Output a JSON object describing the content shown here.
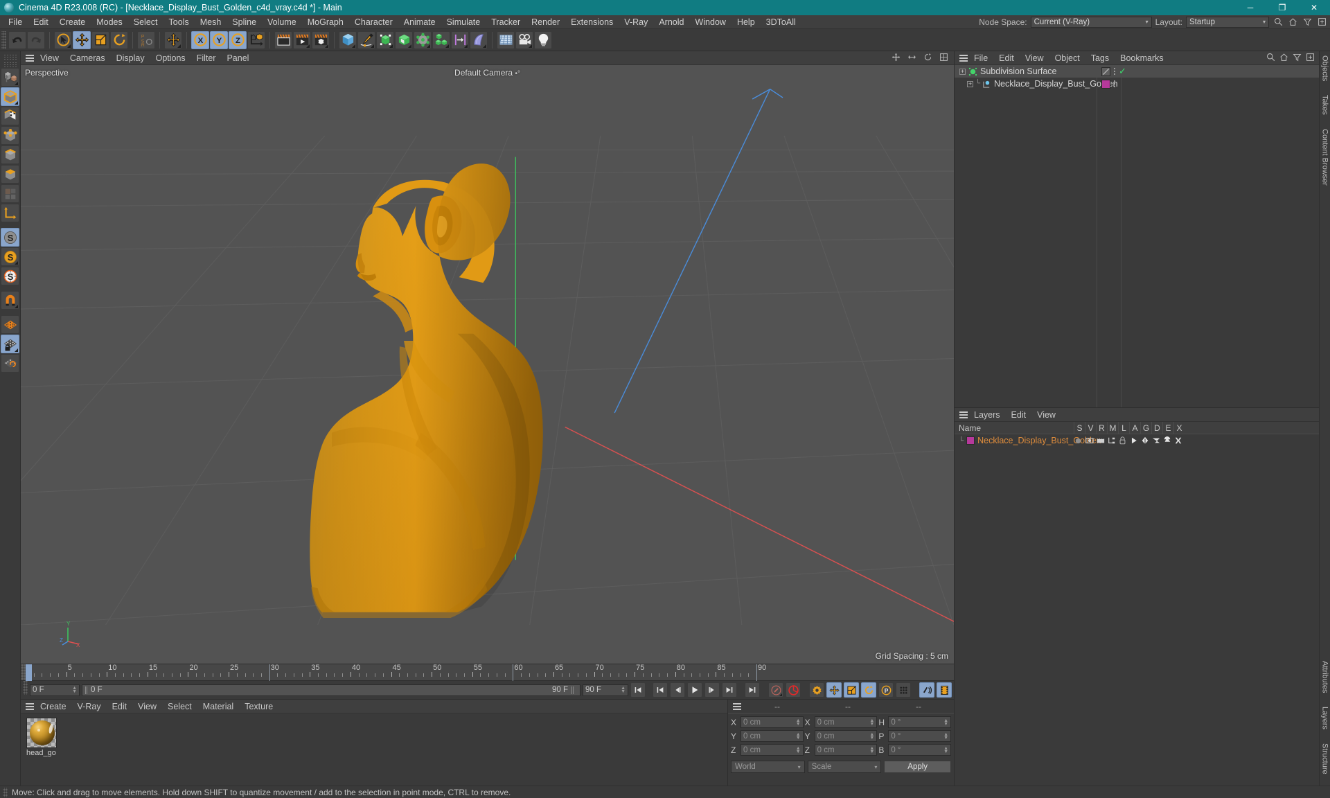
{
  "window": {
    "title": "Cinema 4D R23.008 (RC) - [Necklace_Display_Bust_Golden_c4d_vray.c4d *] - Main",
    "minimize": "─",
    "maximize": "❐",
    "close": "✕"
  },
  "menubar": {
    "items": [
      "File",
      "Edit",
      "Create",
      "Modes",
      "Select",
      "Tools",
      "Mesh",
      "Spline",
      "Volume",
      "MoGraph",
      "Character",
      "Animate",
      "Simulate",
      "Tracker",
      "Render",
      "Extensions",
      "V-Ray",
      "Arnold",
      "Window",
      "Help",
      "3DToAll"
    ],
    "node_space_label": "Node Space:",
    "node_space_value": "Current (V-Ray)",
    "layout_label": "Layout:",
    "layout_value": "Startup"
  },
  "toolbar": {
    "groups": [
      {
        "name": "history",
        "buttons": [
          {
            "icon": "undo-icon",
            "label": "Undo",
            "active": false
          },
          {
            "icon": "redo-icon",
            "label": "Redo",
            "active": false
          }
        ]
      },
      {
        "name": "tools",
        "buttons": [
          {
            "icon": "select-cursor-icon",
            "label": "Live Selection",
            "active": false
          },
          {
            "icon": "move-tool-icon",
            "label": "Move",
            "active": true
          },
          {
            "icon": "scale-tool-icon",
            "label": "Scale",
            "active": false
          },
          {
            "icon": "rotate-tool-icon",
            "label": "Rotate",
            "active": false
          }
        ]
      },
      {
        "name": "psr",
        "buttons": [
          {
            "icon": "psr-icon",
            "label": "PSR",
            "active": false
          }
        ]
      },
      {
        "name": "move-dup",
        "buttons": [
          {
            "icon": "move-tool-icon",
            "label": "Move",
            "active": false
          }
        ]
      },
      {
        "name": "axis-locks",
        "buttons": [
          {
            "icon": "axis-x-icon",
            "label": "X Axis",
            "active": true
          },
          {
            "icon": "axis-y-icon",
            "label": "Y Axis",
            "active": true
          },
          {
            "icon": "axis-z-icon",
            "label": "Z Axis",
            "active": true
          },
          {
            "icon": "world-object-axis-icon",
            "label": "World/Object",
            "active": false
          }
        ]
      },
      {
        "name": "render",
        "buttons": [
          {
            "icon": "render-view-icon",
            "label": "Render View",
            "active": false
          },
          {
            "icon": "render-to-picture-icon",
            "label": "Render to Picture Viewer",
            "active": false
          },
          {
            "icon": "render-settings-icon",
            "label": "Render Settings",
            "active": false
          }
        ]
      },
      {
        "name": "objects",
        "buttons": [
          {
            "icon": "cube-primitive-icon",
            "label": "Add Cube Object",
            "active": false
          },
          {
            "icon": "pen-spline-icon",
            "label": "Add Spline",
            "active": false
          },
          {
            "icon": "generator-icon",
            "label": "Add Generator",
            "active": false
          },
          {
            "icon": "deformer-icon",
            "label": "Add Deformer",
            "active": false
          },
          {
            "icon": "scene-nodes-icon",
            "label": "Add Scene Object",
            "active": false
          },
          {
            "icon": "mograph-icon",
            "label": "MoGraph",
            "active": false
          },
          {
            "icon": "snap-icon",
            "label": "Add Field",
            "active": false
          },
          {
            "icon": "cloth-icon",
            "label": "Add Simulation",
            "active": false
          }
        ]
      },
      {
        "name": "scene",
        "buttons": [
          {
            "icon": "environment-icon",
            "label": "Add Environment",
            "active": false
          },
          {
            "icon": "camera-icon",
            "label": "Add Camera",
            "active": false
          },
          {
            "icon": "light-icon",
            "label": "Add Light",
            "active": false
          }
        ]
      }
    ]
  },
  "lefttools": {
    "buttons": [
      {
        "icon": "make-editable-icon",
        "label": "Make Editable",
        "active": false
      },
      {
        "icon": "model-mode-icon",
        "label": "Model Mode",
        "active": true
      },
      {
        "icon": "texture-mode-icon",
        "label": "Texture Mode",
        "active": false
      },
      {
        "icon": "point-mode-icon",
        "label": "Points",
        "active": false
      },
      {
        "icon": "edge-mode-icon",
        "label": "Edges",
        "active": false
      },
      {
        "icon": "polygon-mode-icon",
        "label": "Polygons",
        "active": false
      },
      {
        "icon": "uv-mode-icon",
        "label": "UV Mesh",
        "active": false
      },
      {
        "icon": "axis-mode-icon",
        "label": "Enable Axis",
        "active": false
      },
      {
        "icon": "snap-s-gray-icon",
        "label": "Enable Snap",
        "active": true
      },
      {
        "icon": "snap-s-orange-icon",
        "label": "Snapping Settings",
        "active": false
      },
      {
        "icon": "snap-s-white-icon",
        "label": "Quantize",
        "active": false
      },
      {
        "icon": "magnet-icon",
        "label": "Magnet",
        "active": false
      },
      {
        "icon": "workplane-icon",
        "label": "Workplane",
        "active": false
      },
      {
        "icon": "workplane-lock-icon",
        "label": "Lock Workplane",
        "active": true
      },
      {
        "icon": "workplane-mode-icon",
        "label": "Planar Workplane",
        "active": false
      }
    ]
  },
  "viewport": {
    "menu": [
      "View",
      "Cameras",
      "Display",
      "Options",
      "Filter",
      "Panel"
    ],
    "projection_label": "Perspective",
    "camera_label": "Default Camera",
    "grid_spacing": "Grid Spacing : 5 cm",
    "axis_labels": {
      "x": "X",
      "y": "Y",
      "z": "Z"
    },
    "model_color": "#e8a117",
    "background_color": "#535353"
  },
  "timeline": {
    "ticks": [
      0,
      5,
      10,
      15,
      20,
      25,
      30,
      35,
      40,
      45,
      50,
      55,
      60,
      65,
      70,
      75,
      80,
      85,
      90
    ],
    "start_frame": "0 F",
    "current_frame": "0 F",
    "preview_min": "0 F",
    "end_frame": "90 F",
    "preview_max": "90 F",
    "range_end": "90 F",
    "transport": [
      {
        "icon": "go-to-start-icon",
        "label": "Go to Start"
      },
      {
        "icon": "previous-key-icon",
        "label": "Go to Previous Key"
      },
      {
        "icon": "step-back-icon",
        "label": "Go to Previous Frame"
      },
      {
        "icon": "play-icon",
        "label": "Play Forwards"
      },
      {
        "icon": "step-forward-icon",
        "label": "Go to Next Frame"
      },
      {
        "icon": "next-key-icon",
        "label": "Go to Next Key"
      },
      {
        "icon": "go-to-end-icon",
        "label": "Go to End"
      }
    ],
    "record_tools": [
      {
        "icon": "autokey-icon",
        "label": "Autokeying",
        "active": false
      },
      {
        "icon": "record-icon",
        "label": "Record Active Objects",
        "active": false
      },
      {
        "icon": "keyframe-selection-icon",
        "label": "Keyframe Selection",
        "active": false
      },
      {
        "icon": "position-key-icon",
        "label": "Position",
        "active": true
      },
      {
        "icon": "scale-key-icon",
        "label": "Scale",
        "active": true
      },
      {
        "icon": "rotation-key-icon",
        "label": "Rotation",
        "active": true
      },
      {
        "icon": "param-key-icon",
        "label": "Parameter",
        "active": true
      },
      {
        "icon": "pla-key-icon",
        "label": "Point Level Animation",
        "active": false
      },
      {
        "icon": "sound-icon",
        "label": "Sound",
        "active": true
      },
      {
        "icon": "timeline-icon",
        "label": "Timeline",
        "active": true
      }
    ]
  },
  "material_manager": {
    "menu": [
      "Create",
      "V-Ray",
      "Edit",
      "View",
      "Select",
      "Material",
      "Texture"
    ],
    "materials": [
      {
        "name": "head_go",
        "selected": false
      }
    ]
  },
  "coordinates": {
    "headers": [
      "--",
      "--",
      "--"
    ],
    "rows": [
      {
        "axis1": "X",
        "value1": "0 cm",
        "axis2": "X",
        "value2": "0 cm",
        "axis3": "H",
        "value3": "0 °"
      },
      {
        "axis1": "Y",
        "value1": "0 cm",
        "axis2": "Y",
        "value2": "0 cm",
        "axis3": "P",
        "value3": "0 °"
      },
      {
        "axis1": "Z",
        "value1": "0 cm",
        "axis2": "Z",
        "value2": "0 cm",
        "axis3": "B",
        "value3": "0 °"
      }
    ],
    "system": "World",
    "mode": "Scale",
    "apply_label": "Apply"
  },
  "object_manager": {
    "menu": [
      "File",
      "Edit",
      "View",
      "Object",
      "Tags",
      "Bookmarks"
    ],
    "rows": [
      {
        "name": "Subdivision Surface",
        "depth": 0,
        "icon": "subdivision-surface-icon",
        "icon_color": "#44d36a",
        "selected": true,
        "tag": "none",
        "has_check": true
      },
      {
        "name": "Necklace_Display_Bust_Golden",
        "depth": 1,
        "icon": "polygon-object-icon",
        "icon_color": "#6ec7ee",
        "selected": false,
        "tag": "#b6399b",
        "has_check": false
      }
    ]
  },
  "layer_manager": {
    "menu": [
      "Layers",
      "Edit",
      "View"
    ],
    "columns": [
      "Name",
      "S",
      "V",
      "R",
      "M",
      "L",
      "A",
      "G",
      "D",
      "E",
      "X"
    ],
    "rows": [
      {
        "name": "Necklace_Display_Bust_Golden",
        "color": "#b6399b",
        "text_color": "#e08d3c"
      }
    ]
  },
  "right_tabs": [
    "Objects",
    "Takes",
    "Content Browser",
    "Attributes",
    "Layers",
    "Structure"
  ],
  "statusbar": {
    "message": "Move: Click and drag to move elements. Hold down SHIFT to quantize movement / add to the selection in point mode, CTRL to remove."
  }
}
